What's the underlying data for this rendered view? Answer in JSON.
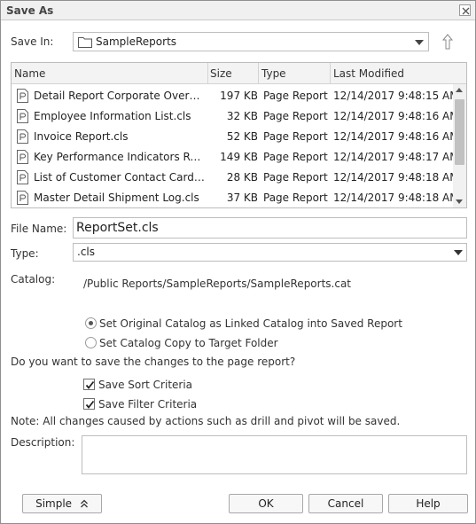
{
  "window": {
    "title": "Save As"
  },
  "save_in": {
    "label": "Save In:",
    "value": "SampleReports"
  },
  "file_list": {
    "columns": [
      "Name",
      "Size",
      "Type",
      "Last Modified"
    ],
    "rows": [
      {
        "name": "Detail Report Corporate Overvie...",
        "size": "197 KB",
        "type": "Page Report",
        "modified": "12/14/2017 9:48:15 AM"
      },
      {
        "name": "Employee Information List.cls",
        "size": "32 KB",
        "type": "Page Report",
        "modified": "12/14/2017 9:48:16 AM"
      },
      {
        "name": "Invoice Report.cls",
        "size": "52 KB",
        "type": "Page Report",
        "modified": "12/14/2017 9:48:16 AM"
      },
      {
        "name": "Key Performance Indicators Rep...",
        "size": "149 KB",
        "type": "Page Report",
        "modified": "12/14/2017 9:48:17 AM"
      },
      {
        "name": "List of Customer Contact Cards.cls",
        "size": "28 KB",
        "type": "Page Report",
        "modified": "12/14/2017 9:48:18 AM"
      },
      {
        "name": "Master Detail Shipment Log.cls",
        "size": "37 KB",
        "type": "Page Report",
        "modified": "12/14/2017 9:48:18 AM"
      }
    ]
  },
  "file_name": {
    "label": "File Name:",
    "value": "ReportSet.cls"
  },
  "type": {
    "label": "Type:",
    "value": ".cls"
  },
  "catalog": {
    "label": "Catalog:",
    "path": "/Public Reports/SampleReports/SampleReports.cat"
  },
  "catalog_options": [
    {
      "label": "Set Original Catalog as Linked Catalog into Saved Report",
      "selected": true
    },
    {
      "label": "Set Catalog Copy to Target Folder",
      "selected": false
    }
  ],
  "save_changes_question": "Do you want to save the changes to the page report?",
  "save_options": [
    {
      "label": "Save Sort Criteria",
      "checked": true
    },
    {
      "label": "Save Filter Criteria",
      "checked": true
    }
  ],
  "note": "Note: All changes caused by actions such as drill and pivot will be saved.",
  "description": {
    "label": "Description:",
    "value": ""
  },
  "buttons": {
    "simple": "Simple",
    "ok": "OK",
    "cancel": "Cancel",
    "help": "Help"
  },
  "icons": {
    "close": "close-icon",
    "folder": "folder-icon",
    "up": "up-folder-icon",
    "file": "report-file-icon",
    "collapse": "double-chevron-up-icon"
  }
}
